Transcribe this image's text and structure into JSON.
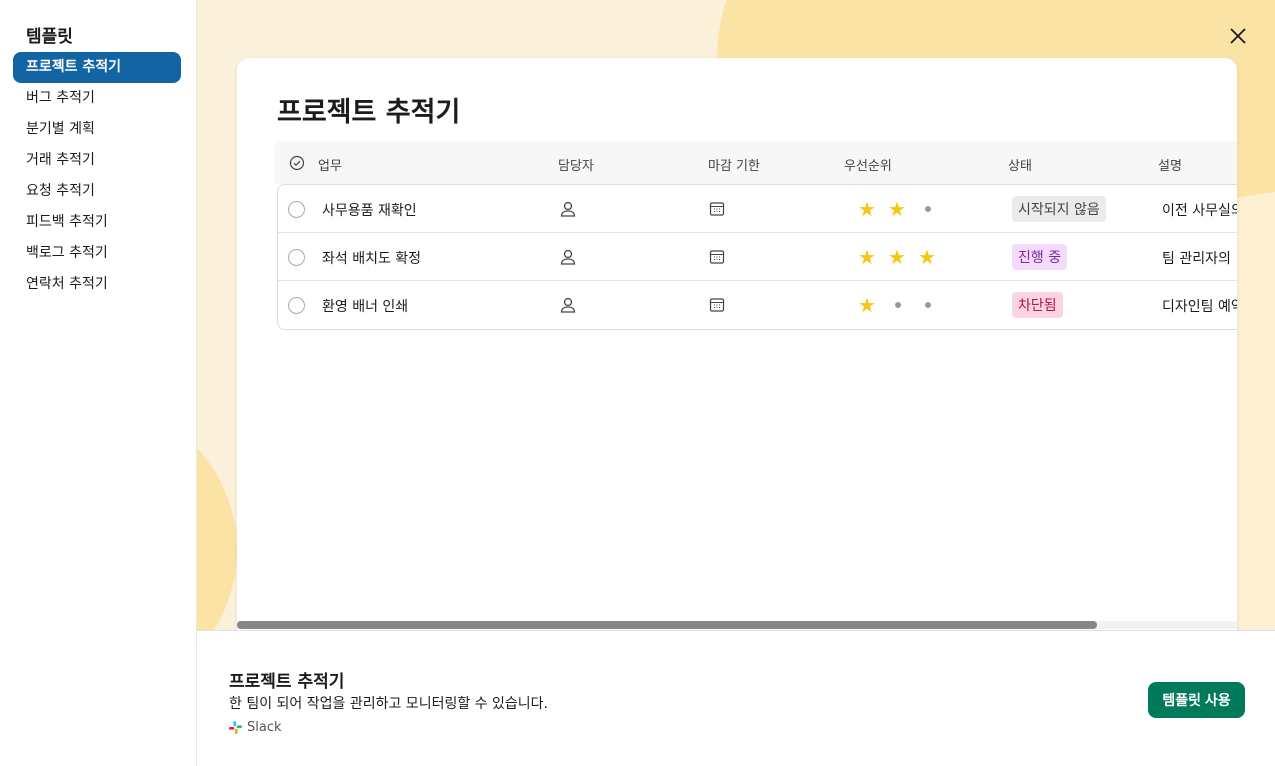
{
  "sidebar": {
    "title": "템플릿",
    "items": [
      {
        "label": "프로젝트 추적기",
        "active": true
      },
      {
        "label": "버그 추적기"
      },
      {
        "label": "분기별 계획"
      },
      {
        "label": "거래 추적기"
      },
      {
        "label": "요청 추적기"
      },
      {
        "label": "피드백 추적기"
      },
      {
        "label": "백로그 추적기"
      },
      {
        "label": "연락처 추적기"
      }
    ]
  },
  "preview": {
    "title": "프로젝트 추적기",
    "columns": [
      "업무",
      "담당자",
      "마감 기한",
      "우선순위",
      "상태",
      "설명"
    ],
    "rows": [
      {
        "task": "사무용품 재확인",
        "priority": 2,
        "status": "시작되지 않음",
        "description": "이전 사무실의"
      },
      {
        "task": "좌석 배치도 확정",
        "priority": 3,
        "status": "진행 중",
        "description": "팀 관리자의"
      },
      {
        "task": "환영 배너 인쇄",
        "priority": 1,
        "status": "차단됨",
        "description": "디자인팀 예약"
      }
    ],
    "horizontal_scroll_fraction": 0.86
  },
  "status_colors": {
    "시작되지 않음": {
      "bg": "#ebebeb",
      "fg": "#454245"
    },
    "진행 중": {
      "bg": "#f4dafc",
      "fg": "#7a2d97"
    },
    "차단됨": {
      "bg": "#fdd5e0",
      "fg": "#b3124a"
    }
  },
  "footer": {
    "title": "프로젝트 추적기",
    "description": "한 팀이 되어 작업을 관리하고 모니터링할 수 있습니다.",
    "source": "Slack",
    "use_button": "템플릿 사용"
  },
  "accent": "#1264a3",
  "button_color": "#007a5a"
}
